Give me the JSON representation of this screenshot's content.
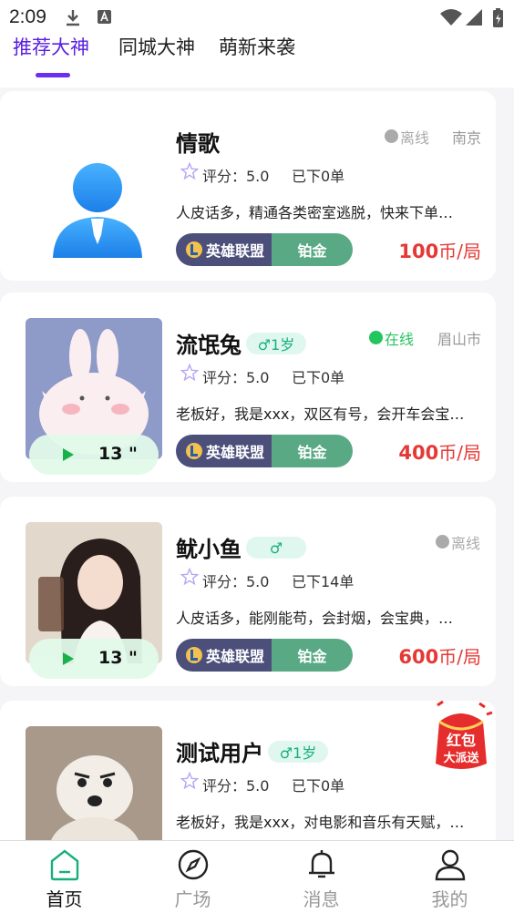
{
  "status_bar": {
    "time": "2:09"
  },
  "tabs": [
    {
      "label": "推荐大神",
      "active": true
    },
    {
      "label": "同城大神",
      "active": false
    },
    {
      "label": "萌新来袭",
      "active": false
    }
  ],
  "cards": [
    {
      "name": "情歌",
      "age": "",
      "status": "离线",
      "online": false,
      "city": "南京",
      "rating": "评分：5.0",
      "orders": "已下0单",
      "desc": "人皮话多，精通各类密室逃脱，快来下单…",
      "game": "英雄联盟",
      "rank": "铂金",
      "price_num": "100",
      "price_unit": "币/局",
      "voice": ""
    },
    {
      "name": "流氓兔",
      "age": "♂1岁",
      "status": "在线",
      "online": true,
      "city": "眉山市",
      "rating": "评分：5.0",
      "orders": "已下0单",
      "desc": "老板好，我是xxx，双区有号，会开车会宝…",
      "game": "英雄联盟",
      "rank": "铂金",
      "price_num": "400",
      "price_unit": "币/局",
      "voice": "13 \""
    },
    {
      "name": "鱿小鱼",
      "age": "♂",
      "status": "离线",
      "online": false,
      "city": "",
      "rating": "评分：5.0",
      "orders": "已下14单",
      "desc": "人皮话多，能刚能苟，会封烟，会宝典，…",
      "game": "英雄联盟",
      "rank": "铂金",
      "price_num": "600",
      "price_unit": "币/局",
      "voice": "13 \""
    },
    {
      "name": "测试用户",
      "age": "♂1岁",
      "status": "",
      "online": false,
      "city": "",
      "rating": "评分：5.0",
      "orders": "已下0单",
      "desc": "老板好，我是xxx，对电影和音乐有天赋，…",
      "game": "",
      "rank": "",
      "price_num": "",
      "price_unit": "",
      "voice": ""
    }
  ],
  "redpacket": {
    "line1": "红包",
    "line2": "大派送"
  },
  "bottom_nav": [
    {
      "label": "首页",
      "icon": "home-icon",
      "active": true
    },
    {
      "label": "广场",
      "icon": "compass-icon",
      "active": false
    },
    {
      "label": "消息",
      "icon": "bell-icon",
      "active": false
    },
    {
      "label": "我的",
      "icon": "user-icon",
      "active": false
    }
  ],
  "colors": {
    "accent": "#5a1fe0",
    "online": "#22c55e",
    "price": "#e53935",
    "tag_game": "#4b4f7a",
    "tag_rank": "#59a985"
  }
}
